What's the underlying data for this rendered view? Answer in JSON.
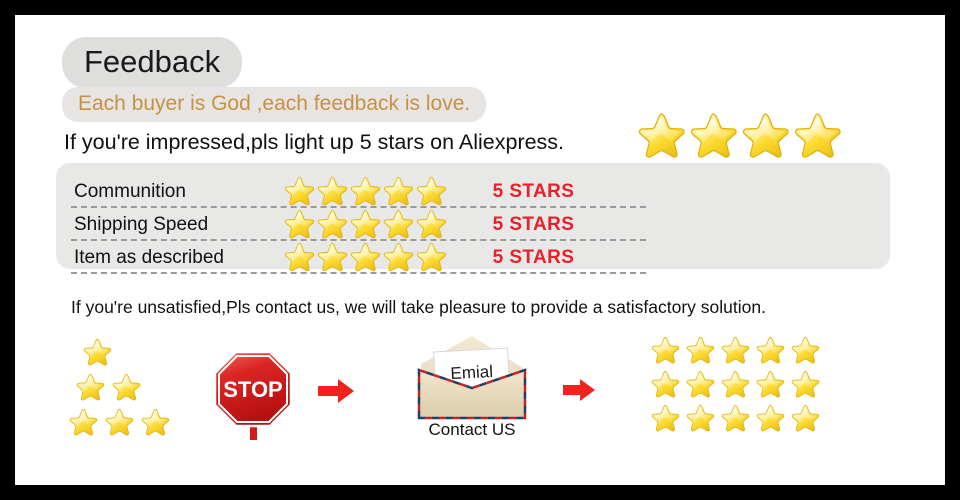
{
  "page": {
    "frame_color": "#000000",
    "canvas_color": "#ffffff"
  },
  "header": {
    "title": "Feedback",
    "tagline": "Each buyer is God ,each feedback is love.",
    "subline": "If you're impressed,pls light up 5 stars on Aliexpress.",
    "tagline_color": "#c8913f",
    "pill_color": "#dededd",
    "big_stars_count": 4,
    "big_star_icon": "star-icon"
  },
  "ratings": {
    "panel_color": "#e8e8e7",
    "value_color": "#e8202a",
    "stars_per_row": 5,
    "rows": [
      {
        "label": "Communition",
        "stars": 5,
        "value": "5 STARS"
      },
      {
        "label": "Shipping Speed",
        "stars": 5,
        "value": "5 STARS"
      },
      {
        "label": "Item as described",
        "stars": 5,
        "value": "5 STARS"
      }
    ]
  },
  "notice": {
    "text": "If you're unsatisfied,Pls contact us, we will take pleasure to provide a satisfactory solution."
  },
  "flow": {
    "pyramid": {
      "icon": "star-icon",
      "rows": [
        1,
        2,
        3
      ]
    },
    "stop_sign": {
      "icon": "stop-sign-icon",
      "label": "STOP",
      "color": "#d41a1a"
    },
    "arrow_first": {
      "icon": "arrow-right-icon",
      "color": "#f2231f"
    },
    "envelope": {
      "icon": "envelope-icon",
      "letter_text": "Emial",
      "caption": "Contact US"
    },
    "arrow_second": {
      "icon": "arrow-right-icon",
      "color": "#f2231f"
    },
    "star_grid": {
      "icon": "star-icon",
      "columns": 5,
      "rows": 3
    }
  }
}
